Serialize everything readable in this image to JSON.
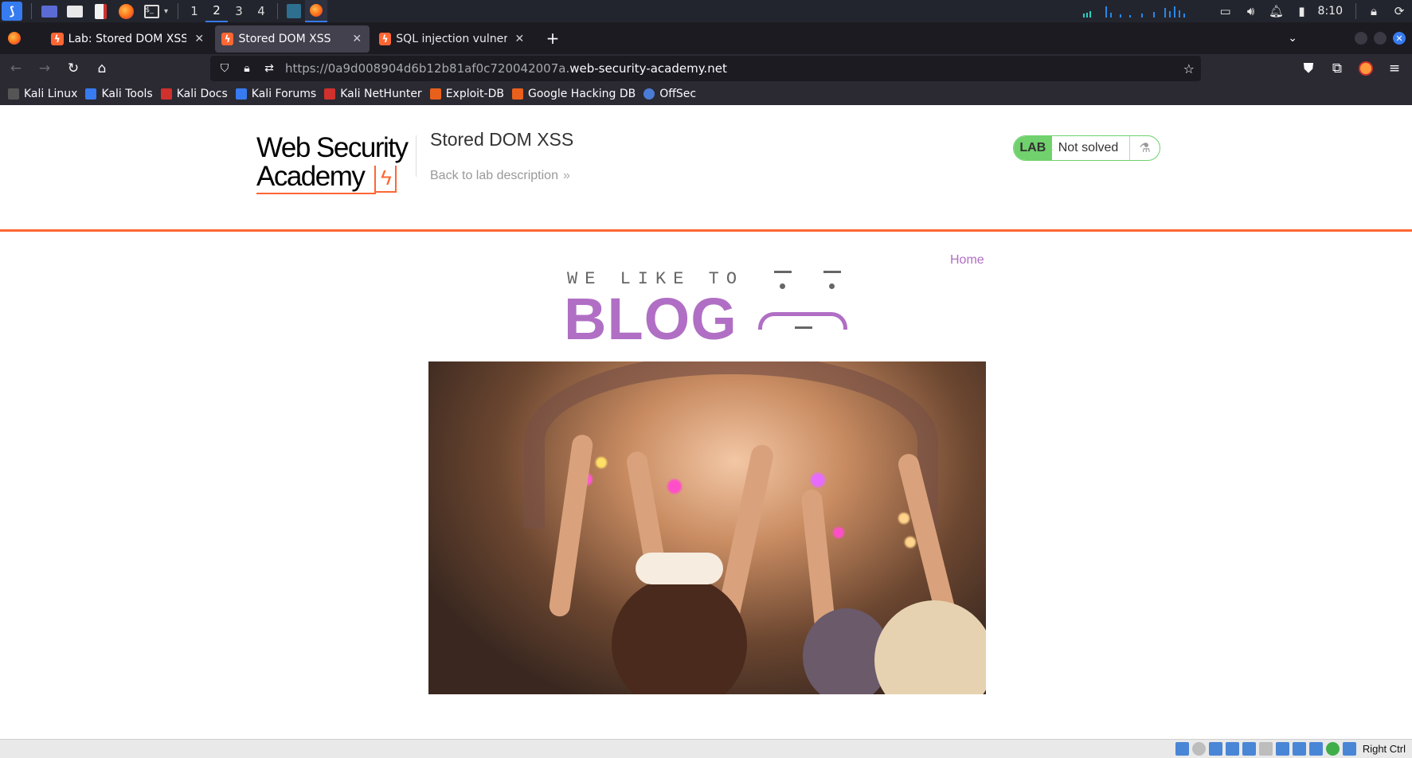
{
  "taskbar": {
    "workspaces": [
      "1",
      "2",
      "3",
      "4"
    ],
    "active_workspace": "2",
    "clock": "8:10"
  },
  "browser": {
    "tabs": [
      {
        "title": "Lab: Stored DOM XSS | W",
        "active": false
      },
      {
        "title": "Stored DOM XSS",
        "active": true
      },
      {
        "title": "SQL injection vulnerability",
        "active": false
      }
    ],
    "url_prefix": "https://0a9d008904d6b12b81af0c720042007a.",
    "url_host": "web-security-academy.net"
  },
  "bookmarks": [
    {
      "label": "Kali Linux",
      "color": "#2a2a2a"
    },
    {
      "label": "Kali Tools",
      "color": "#367bf0"
    },
    {
      "label": "Kali Docs",
      "color": "#d0312d"
    },
    {
      "label": "Kali Forums",
      "color": "#367bf0"
    },
    {
      "label": "Kali NetHunter",
      "color": "#d0312d"
    },
    {
      "label": "Exploit-DB",
      "color": "#e8601c"
    },
    {
      "label": "Google Hacking DB",
      "color": "#e8601c"
    },
    {
      "label": "OffSec",
      "color": "#4a7bd6"
    }
  ],
  "page": {
    "logo_line1": "Web Security",
    "logo_line2": "Academy",
    "lab_title": "Stored DOM XSS",
    "back_link": "Back to lab description",
    "status_lab": "LAB",
    "status_text": "Not solved",
    "home_link": "Home",
    "banner_tagline": "WE LIKE TO",
    "banner_big": "BLOG",
    "accent_color": "#ff6633",
    "blog_color": "#b06fc4"
  },
  "vbox": {
    "hostkey": "Right Ctrl"
  }
}
